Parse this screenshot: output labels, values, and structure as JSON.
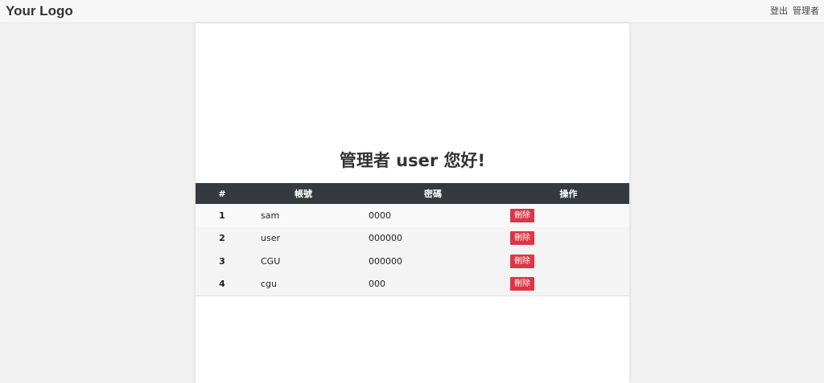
{
  "navbar": {
    "logo": "Your Logo",
    "logout": "登出",
    "admin": "管理者"
  },
  "main": {
    "title": "管理者 user 您好!",
    "table": {
      "headers": [
        "#",
        "帳號",
        "密碼",
        "操作"
      ],
      "delete_label": "刪除",
      "rows": [
        {
          "num": "1",
          "account": "sam",
          "password": "0000"
        },
        {
          "num": "2",
          "account": "user",
          "password": "000000"
        },
        {
          "num": "3",
          "account": "CGU",
          "password": "000000"
        },
        {
          "num": "4",
          "account": "cgu",
          "password": "000"
        }
      ]
    }
  },
  "colors": {
    "header_bg": "#343a40",
    "delete_bg": "#dc3545",
    "page_bg": "#f1f1f1"
  }
}
